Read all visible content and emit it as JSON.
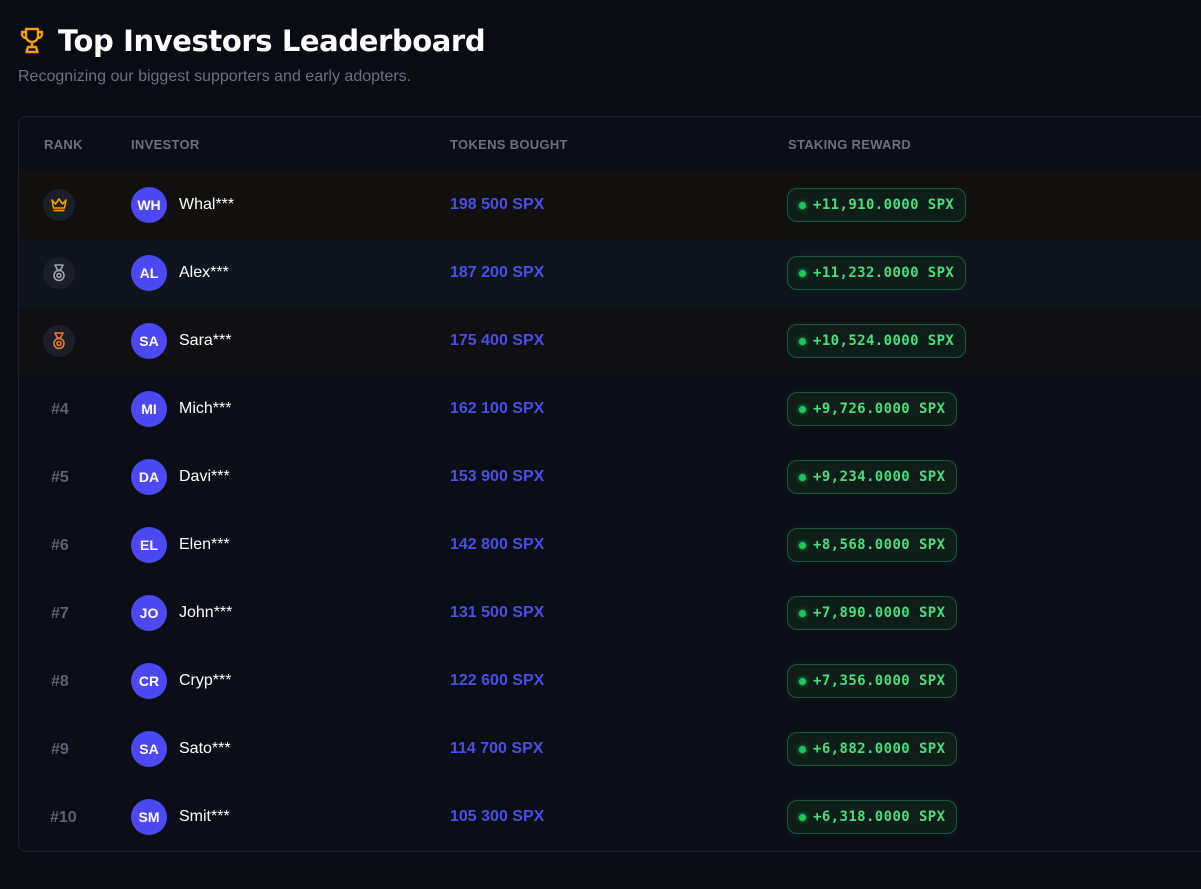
{
  "header": {
    "title": "Top Investors Leaderboard",
    "subtitle": "Recognizing our biggest supporters and early adopters.",
    "icon": "trophy-icon"
  },
  "table": {
    "columns": [
      "RANK",
      "INVESTOR",
      "TOKENS BOUGHT",
      "STAKING REWARD"
    ],
    "rows": [
      {
        "rank": "1",
        "badge": "crown-icon",
        "initials": "WH",
        "name": "Whal***",
        "tokens": "198 500 SPX",
        "reward": "+11,910.0000 SPX"
      },
      {
        "rank": "2",
        "badge": "silver-medal-icon",
        "initials": "AL",
        "name": "Alex***",
        "tokens": "187 200 SPX",
        "reward": "+11,232.0000 SPX"
      },
      {
        "rank": "3",
        "badge": "bronze-medal-icon",
        "initials": "SA",
        "name": "Sara***",
        "tokens": "175 400 SPX",
        "reward": "+10,524.0000 SPX"
      },
      {
        "rank": "#4",
        "initials": "MI",
        "name": "Mich***",
        "tokens": "162 100 SPX",
        "reward": "+9,726.0000 SPX"
      },
      {
        "rank": "#5",
        "initials": "DA",
        "name": "Davi***",
        "tokens": "153 900 SPX",
        "reward": "+9,234.0000 SPX"
      },
      {
        "rank": "#6",
        "initials": "EL",
        "name": "Elen***",
        "tokens": "142 800 SPX",
        "reward": "+8,568.0000 SPX"
      },
      {
        "rank": "#7",
        "initials": "JO",
        "name": "John***",
        "tokens": "131 500 SPX",
        "reward": "+7,890.0000 SPX"
      },
      {
        "rank": "#8",
        "initials": "CR",
        "name": "Cryp***",
        "tokens": "122 600 SPX",
        "reward": "+7,356.0000 SPX"
      },
      {
        "rank": "#9",
        "initials": "SA",
        "name": "Sato***",
        "tokens": "114 700 SPX",
        "reward": "+6,882.0000 SPX"
      },
      {
        "rank": "#10",
        "initials": "SM",
        "name": "Smit***",
        "tokens": "105 300 SPX",
        "reward": "+6,318.0000 SPX"
      }
    ]
  },
  "colors": {
    "background": "#0b0b14",
    "accent": "#4b4ee6",
    "avatar": "#4c48f4",
    "reward": "#4ade80",
    "gold": "#f59e0b",
    "silver": "#9ca3af",
    "bronze": "#ea7a2b"
  }
}
